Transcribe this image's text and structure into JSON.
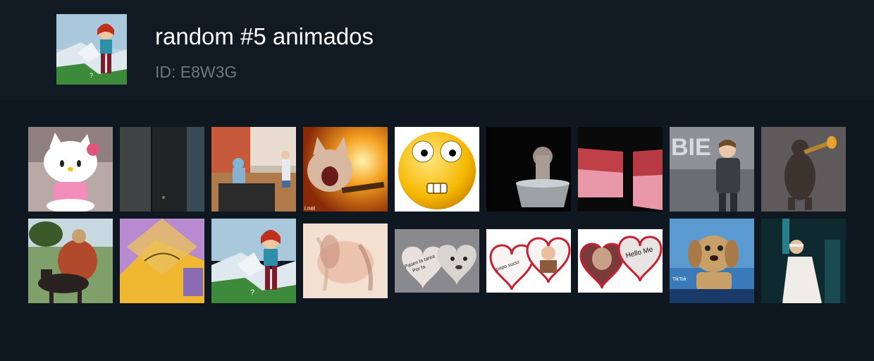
{
  "header": {
    "title": "random #5 animados",
    "id_text": "ID: E8W3G"
  },
  "gifs": [
    {
      "row": 1,
      "index": 1,
      "subject": "hello-kitty"
    },
    {
      "row": 1,
      "index": 2,
      "subject": "dark-door"
    },
    {
      "row": 1,
      "index": 3,
      "subject": "room-scene"
    },
    {
      "row": 1,
      "index": 4,
      "subject": "screaming-cat-fire"
    },
    {
      "row": 1,
      "index": 5,
      "subject": "emoji-face"
    },
    {
      "row": 1,
      "index": 6,
      "subject": "cat-in-tub"
    },
    {
      "row": 1,
      "index": 7,
      "subject": "pink-bed"
    },
    {
      "row": 1,
      "index": 8,
      "subject": "singer-dancing"
    },
    {
      "row": 1,
      "index": 9,
      "subject": "bear-trumpet"
    },
    {
      "row": 2,
      "index": 1,
      "subject": "horse-rider"
    },
    {
      "row": 2,
      "index": 2,
      "subject": "yellow-room"
    },
    {
      "row": 2,
      "index": 3,
      "subject": "roblox-avatar"
    },
    {
      "row": 2,
      "index": 4,
      "subject": "blurry-horse"
    },
    {
      "row": 2,
      "index": 5,
      "subject": "hearts-dog"
    },
    {
      "row": 2,
      "index": 6,
      "subject": "heart-boy"
    },
    {
      "row": 2,
      "index": 7,
      "subject": "heart-hello-me"
    },
    {
      "row": 2,
      "index": 8,
      "subject": "talking-dog"
    },
    {
      "row": 2,
      "index": 9,
      "subject": "dancer-white-coat"
    }
  ],
  "tile_texts": {
    "bie": "BIE",
    "pasen": "Pasen la tarea",
    "porfa": "Por fa",
    "papo": "papo sucio",
    "hello": "Hello Me",
    "tiktok": "TikTok",
    "net": "i.net",
    "question": "?"
  }
}
